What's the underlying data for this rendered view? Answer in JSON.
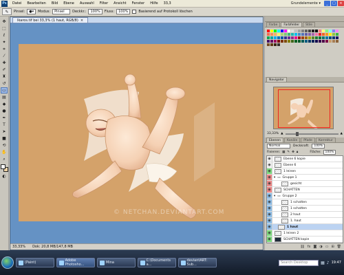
{
  "menubar": {
    "logo": "Ps",
    "items": [
      "Datei",
      "Bearbeiten",
      "Bild",
      "Ebene",
      "Auswahl",
      "Filter",
      "Ansicht",
      "Fenster",
      "Hilfe"
    ],
    "zoom": "33,3",
    "workspace": "Grundelemente ▾"
  },
  "options": {
    "pinsel_label": "Pinsel:",
    "modus_label": "Modus:",
    "modus_value": "Pinsel",
    "deckkr_label": "Deckkr.:",
    "deckkr_value": "100%",
    "fluss_label": "Fluss:",
    "fluss_value": "100%",
    "protocol_label": "Basierend auf Protokoll löschen"
  },
  "document": {
    "tab_title": "Ikaros.tif bei 33,3% (1 haut, RGB/8)",
    "watermark": "© NETCHAN.DEVIANTART.COM",
    "status_zoom": "33,33%",
    "status_doc": "Dok: 20,8 MB/147,8 MB"
  },
  "swatches_panel": {
    "tabs": [
      "Farbe",
      "Farbfelder",
      "Stile"
    ],
    "colors": [
      "#ff0000",
      "#ffff00",
      "#00ff00",
      "#00ffff",
      "#0000ff",
      "#ff00ff",
      "#ffffff",
      "#e0e0e0",
      "#c0c0c0",
      "#a0a0a0",
      "#808080",
      "#606060",
      "#404040",
      "#202020",
      "#000000",
      "#ff8080",
      "#ffff80",
      "#80ff80",
      "#80ffff",
      "#8080ff",
      "#ff80ff",
      "#f26c4f",
      "#f68e56",
      "#fbaf5c",
      "#fff467",
      "#acd372",
      "#7cc576",
      "#3bb878",
      "#1abbb4",
      "#00bff3",
      "#438ccb",
      "#5574b9",
      "#605ca8",
      "#855fa8",
      "#a763a9",
      "#f06ea9",
      "#ed1c24",
      "#f26522",
      "#f7941d",
      "#fff200",
      "#8dc63f",
      "#39b54a",
      "#00a651",
      "#00a99d",
      "#00aeef",
      "#0072bc",
      "#0054a6",
      "#2e3192",
      "#662d91",
      "#92278f",
      "#ec008c",
      "#9e0b0f",
      "#a0410d",
      "#a3620a",
      "#aba000",
      "#598527",
      "#197b30",
      "#007236",
      "#00746b",
      "#0076a3",
      "#004a80",
      "#003471",
      "#1b1464",
      "#440e62",
      "#630460",
      "#9e005d",
      "#790000",
      "#7b2e00",
      "#7d4900",
      "#827b00",
      "#406618",
      "#005e20",
      "#005826",
      "#005952",
      "#005b7f",
      "#003663",
      "#002157",
      "#0d004c",
      "#32004b",
      "#4b0049",
      "#7b0046",
      "#c69c6d",
      "#a67c52",
      "#8c6239",
      "#754c24",
      "#603913",
      "#3c2415",
      "#362f2d"
    ]
  },
  "navigator": {
    "tab": "Navigator",
    "zoom": "33,33%"
  },
  "layers": {
    "tabs": [
      "Ebenen",
      "Kanäle",
      "Pfade",
      "Korrektur"
    ],
    "blend_mode": "Normal",
    "opacity_label": "Deckkraft:",
    "opacity_value": "100%",
    "lock_label": "Fixieren:",
    "fill_label": "Fläche:",
    "fill_value": "100%",
    "rows": [
      {
        "name": "Ebene 6 kopie",
        "eye": "none",
        "thumb": "check",
        "indent": 0
      },
      {
        "name": "Ebene 6",
        "eye": "none",
        "thumb": "check",
        "indent": 0
      },
      {
        "name": "1 leinen",
        "eye": "green",
        "thumb": "check",
        "indent": 0
      },
      {
        "name": "Gruppe 1",
        "eye": "red",
        "thumb": "folder",
        "indent": 0
      },
      {
        "name": "gesicht",
        "eye": "red",
        "thumb": "check",
        "indent": 2
      },
      {
        "name": "SCHATTEN",
        "eye": "red",
        "thumb": "check",
        "indent": 0
      },
      {
        "name": "Gruppe 2",
        "eye": "blue",
        "thumb": "folder",
        "indent": 0
      },
      {
        "name": "1 schatten",
        "eye": "blue",
        "thumb": "check",
        "indent": 2
      },
      {
        "name": "1 schatten",
        "eye": "blue",
        "thumb": "check",
        "indent": 2
      },
      {
        "name": "2 haut",
        "eye": "blue",
        "thumb": "check",
        "indent": 2
      },
      {
        "name": "1. haut",
        "eye": "blue",
        "thumb": "check",
        "indent": 2
      },
      {
        "name": "1 haut",
        "eye": "blue",
        "thumb": "check",
        "indent": 1,
        "selected": true
      },
      {
        "name": "1 leinen 2",
        "eye": "green",
        "thumb": "check",
        "indent": 0
      },
      {
        "name": "SCHATTEN kopie",
        "eye": "green",
        "thumb": "dark",
        "indent": 0
      },
      {
        "name": "rose",
        "eye": "none",
        "thumb": "tan",
        "indent": 0
      }
    ]
  },
  "taskbar": {
    "buttons": [
      {
        "label": "(Paint)",
        "active": false
      },
      {
        "label": "Adobe Photosho...",
        "active": true
      },
      {
        "label": "Mina",
        "active": false
      },
      {
        "label": "C:\\Documents a...",
        "active": false
      },
      {
        "label": "deviantART: Sub...",
        "active": false
      }
    ],
    "search_placeholder": "Search Desktop",
    "clock": "19:47"
  }
}
